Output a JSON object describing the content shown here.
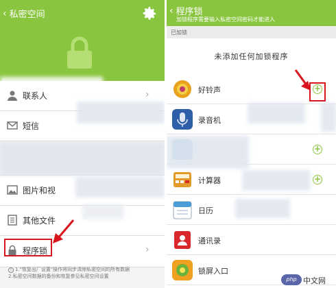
{
  "left": {
    "title": "私密空间",
    "items": [
      {
        "label": "联系人",
        "icon": "person-icon"
      },
      {
        "label": "短信",
        "icon": "envelope-icon"
      },
      {
        "label": "",
        "icon": ""
      },
      {
        "label": "图片和视",
        "icon": "image-icon"
      },
      {
        "label": "其他文件",
        "icon": "file-icon"
      },
      {
        "label": "程序锁",
        "icon": "lock-icon"
      }
    ],
    "note_lines": [
      "1.\"恢复出厂设置\"操作将同步清除私密空间的所有数据",
      "2.私密空间数据的备份和恢复参见私密空间设置"
    ]
  },
  "right": {
    "title": "程序锁",
    "subtitle": "加锁程序需要输入私密空间密码才能进入",
    "section_label": "已加锁",
    "empty_text": "未添加任何加锁程序",
    "apps": [
      {
        "name": "好铃声",
        "icon": "ringtone-app-icon",
        "color": "#e8a21d"
      },
      {
        "name": "录音机",
        "icon": "microphone-app-icon",
        "color": "#2f5fa8"
      },
      {
        "name": "",
        "icon": "blurred-app-icon",
        "color": "#9fc6e6"
      },
      {
        "name": "计算器",
        "icon": "calculator-app-icon",
        "color": "#e39a2b"
      },
      {
        "name": "日历",
        "icon": "calendar-app-icon",
        "color": "#4a9bd6"
      },
      {
        "name": "通讯录",
        "icon": "contacts-app-icon",
        "color": "#d8282c"
      },
      {
        "name": "锁屏入口",
        "icon": "lockscreen-app-icon",
        "color": "#f0a020"
      }
    ]
  },
  "watermark": {
    "badge": "php",
    "text": "中文网"
  },
  "colors": {
    "accent": "#8ac53f",
    "highlight": "#d8141c"
  }
}
